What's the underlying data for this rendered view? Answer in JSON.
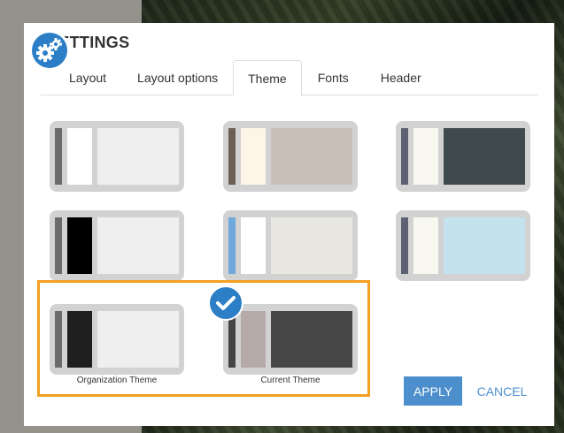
{
  "dialog": {
    "title": "SETTINGS"
  },
  "tabs": [
    {
      "label": "Layout",
      "active": false
    },
    {
      "label": "Layout options",
      "active": false
    },
    {
      "label": "Theme",
      "active": true
    },
    {
      "label": "Fonts",
      "active": false
    },
    {
      "label": "Header",
      "active": false
    }
  ],
  "themes": [
    {
      "colors": {
        "stripe": "#6b6b6b",
        "side": "#ffffff",
        "main": "#efefef"
      },
      "label": ""
    },
    {
      "colors": {
        "stripe": "#6e5f55",
        "side": "#fdf6e8",
        "main": "#c9bfb8"
      },
      "label": ""
    },
    {
      "colors": {
        "stripe": "#5c6272",
        "side": "#f8f8f0",
        "main": "#3f4a4f"
      },
      "label": ""
    },
    {
      "colors": {
        "stripe": "#6b6b6b",
        "side": "#000000",
        "main": "#efefef"
      },
      "label": ""
    },
    {
      "colors": {
        "stripe": "#6fa8dc",
        "side": "#ffffff",
        "main": "#e8e8e0"
      },
      "label": ""
    },
    {
      "colors": {
        "stripe": "#5c6272",
        "side": "#f8f8f0",
        "main": "#c3e2ee"
      },
      "label": ""
    },
    {
      "colors": {
        "stripe": "#6b6b6b",
        "side": "#1e1e1e",
        "main": "#efefef"
      },
      "label": "Organization Theme"
    },
    {
      "colors": {
        "stripe": "#444444",
        "side": "#b5aaa8",
        "main": "#474747"
      },
      "label": "Current Theme",
      "selected": true
    }
  ],
  "actions": {
    "apply_label": "APPLY",
    "cancel_label": "CANCEL"
  },
  "colors": {
    "accent": "#2c7fc6",
    "button": "#4d8fcc",
    "highlight": "#f4a020"
  },
  "icons": {
    "settings": "gears-icon",
    "selected": "checkmark-icon"
  }
}
